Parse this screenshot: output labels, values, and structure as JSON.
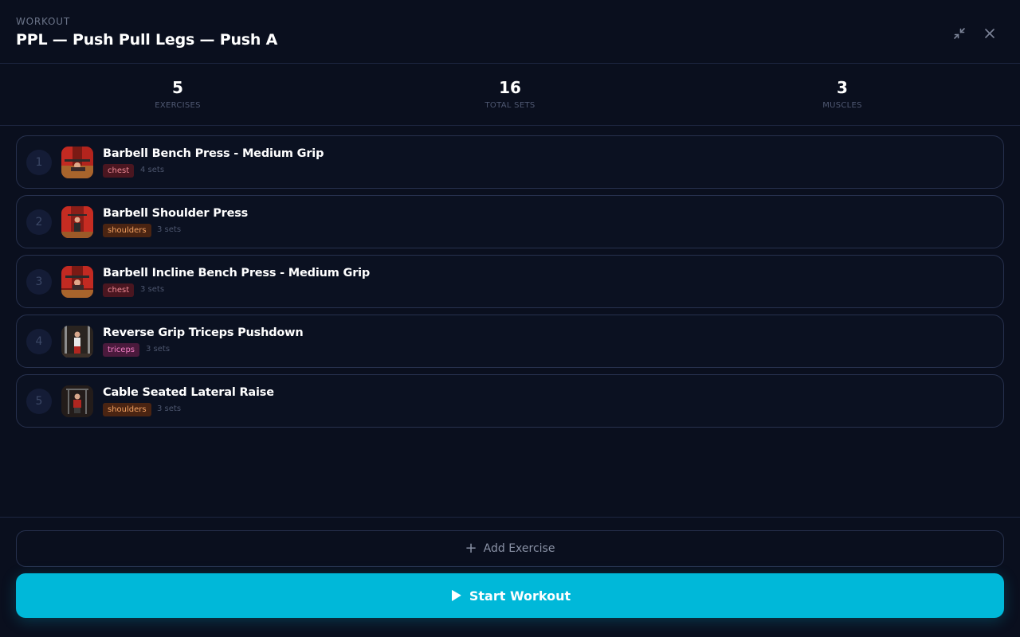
{
  "header": {
    "eyebrow": "WORKOUT",
    "title": "PPL — Push Pull Legs — Push A"
  },
  "stats": [
    {
      "value": "5",
      "label": "EXERCISES"
    },
    {
      "value": "16",
      "label": "TOTAL SETS"
    },
    {
      "value": "3",
      "label": "MUSCLES"
    }
  ],
  "exercises": [
    {
      "index": "1",
      "name": "Barbell Bench Press - Medium Grip",
      "muscle": "chest",
      "sets": "4 sets",
      "thumb_icon": "bench-press-photo"
    },
    {
      "index": "2",
      "name": "Barbell Shoulder Press",
      "muscle": "shoulders",
      "sets": "3 sets",
      "thumb_icon": "shoulder-press-photo"
    },
    {
      "index": "3",
      "name": "Barbell Incline Bench Press - Medium Grip",
      "muscle": "chest",
      "sets": "3 sets",
      "thumb_icon": "incline-press-photo"
    },
    {
      "index": "4",
      "name": "Reverse Grip Triceps Pushdown",
      "muscle": "triceps",
      "sets": "3 sets",
      "thumb_icon": "triceps-pushdown-photo"
    },
    {
      "index": "5",
      "name": "Cable Seated Lateral Raise",
      "muscle": "shoulders",
      "sets": "3 sets",
      "thumb_icon": "lateral-raise-photo"
    }
  ],
  "actions": {
    "add_label": "Add Exercise",
    "add_icon": "plus-icon",
    "start_label": "Start Workout",
    "start_icon": "play-icon"
  },
  "colors": {
    "background": "#0a0f1e",
    "accent": "#00b8d9",
    "chest_tag": "#4a1620",
    "shoulders_tag": "#4a2412",
    "triceps_tag": "#4a1a3c"
  }
}
